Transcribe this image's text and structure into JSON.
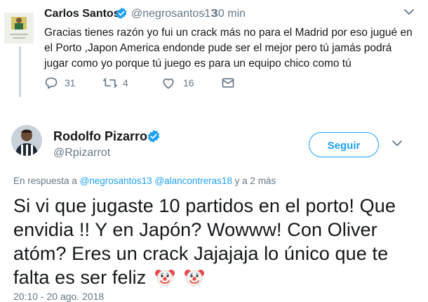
{
  "tweet1": {
    "name": "Carlos Santos",
    "handle": "@negrosantos13",
    "separator": "·",
    "time": "30 min",
    "text": "Gracias tienes razón yo fui un crack más no para el Madrid por eso jugué en el Porto ,Japon America endonde pude ser el mejor pero tú jamás podrá jugar como yo porque tú juego es para un equipo chico como tú",
    "reply_count": "31",
    "retweet_count": "4",
    "like_count": "16"
  },
  "tweet2": {
    "name": "Rodolfo Pizarro",
    "handle": "@Rpizarrot",
    "follow_label": "Seguir",
    "reply_prefix": "En respuesta a",
    "mention1": "@negrosantos13",
    "mention2": "@alancontreras18",
    "reply_suffix": "y a 2 más",
    "text": "Si vi que jugaste 10 partidos en el porto! Que envidia !! Y en Japón? Wowww! Con Oliver atóm? Eres un crack Jajajaja lo único que te falta es ser feliz",
    "date": "20:10 - 20 ago. 2018"
  },
  "colors": {
    "accent": "#1da1f2",
    "secondary_text": "#657786",
    "primary_text": "#14171a",
    "thread_line": "#ccd6dd"
  },
  "icons": {
    "verified": "verified-badge-icon",
    "caret": "chevron-down-icon",
    "reply": "reply-icon",
    "retweet": "retweet-icon",
    "like": "heart-icon",
    "dm": "envelope-icon",
    "emoji": "clown-face-emoji"
  }
}
